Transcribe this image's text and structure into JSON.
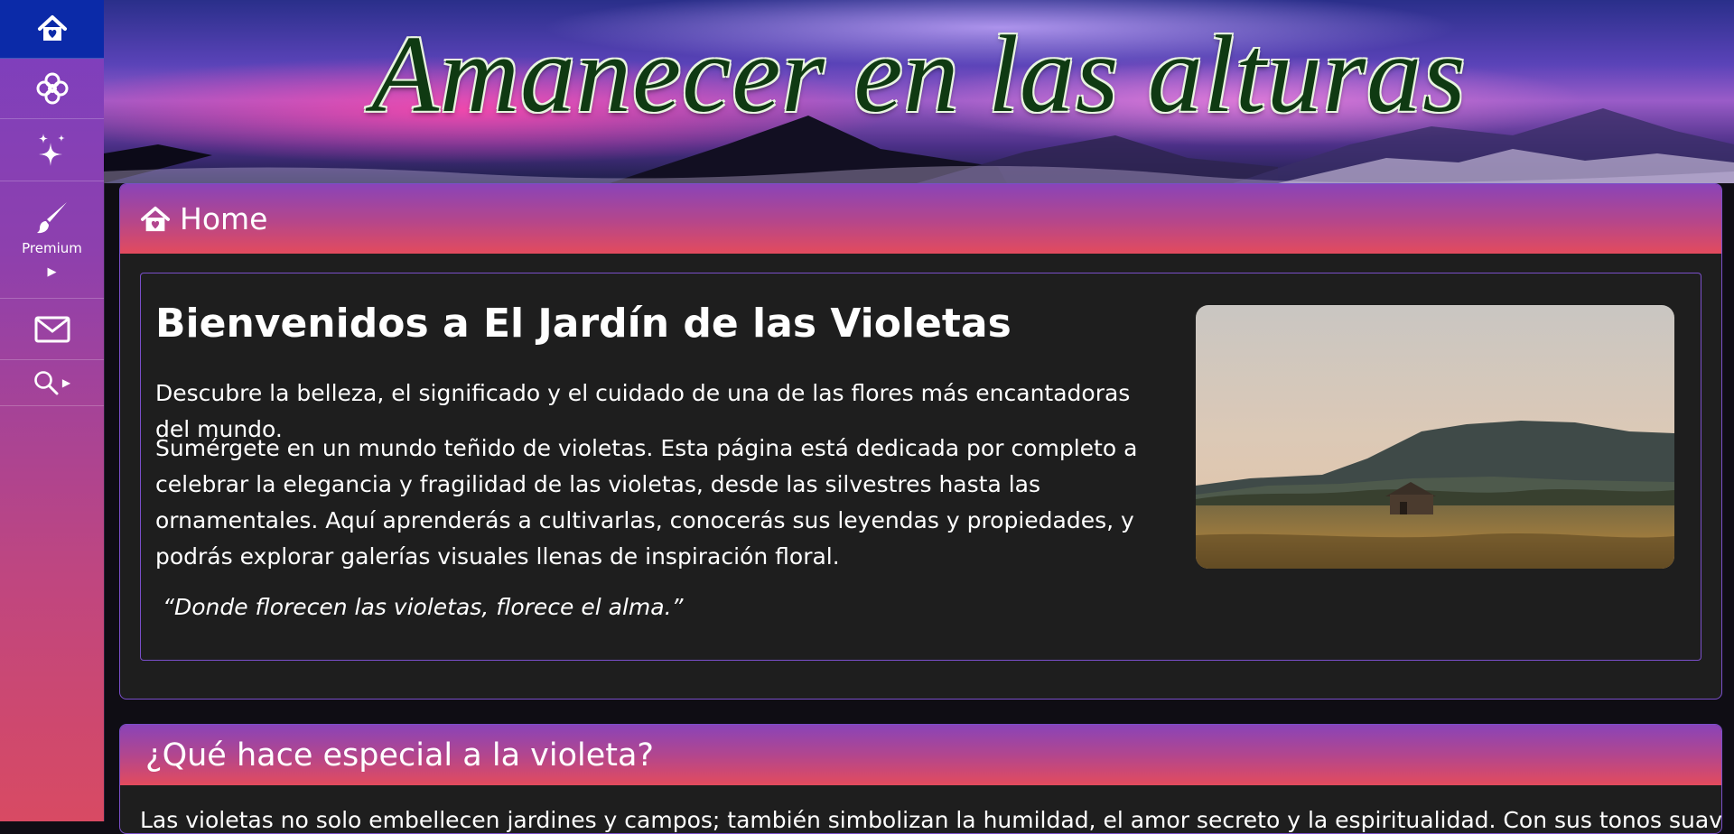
{
  "sidebar": {
    "items": [
      {
        "icon": "home-icon",
        "label": ""
      },
      {
        "icon": "flower-icon",
        "label": ""
      },
      {
        "icon": "sparkles-icon",
        "label": ""
      },
      {
        "icon": "brush-icon",
        "label": "Premium"
      },
      {
        "icon": "envelope-icon",
        "label": ""
      },
      {
        "icon": "search-icon",
        "label": ""
      }
    ],
    "active_color": "#0b2aa8"
  },
  "banner": {
    "title": "Amanecer en las alturas"
  },
  "home_panel": {
    "header_icon": "home-icon",
    "header_title": "Home",
    "welcome_title": "Bienvenidos a El Jardín de las Violetas",
    "intro": "Descubre la belleza, el significado y el cuidado de una de las flores más encantadoras del mundo.",
    "body": "Sumérgete en un mundo teñido de violetas. Esta página está dedicada por completo a celebrar la elegancia y fragilidad de las violetas, desde las silvestres hasta las ornamentales. Aquí aprenderás a cultivarlas, conocerás sus leyendas y propiedades, y podrás explorar galerías visuales llenas de inspiración floral.",
    "quote": "“Donde florecen las violetas, florece el alma.”",
    "image": "landscape-photo"
  },
  "special_panel": {
    "title": "¿Qué hace especial a la violeta?",
    "text": "Las violetas no solo embellecen jardines y campos; también simbolizan la humildad, el amor secreto y la espiritualidad. Con sus tonos suaves y su"
  },
  "colors": {
    "panel_bg": "#1e1e1e",
    "border_purple": "#7a4fc9",
    "header_gradient_top": "#8a44b8",
    "header_gradient_bottom": "#e34b5d"
  }
}
